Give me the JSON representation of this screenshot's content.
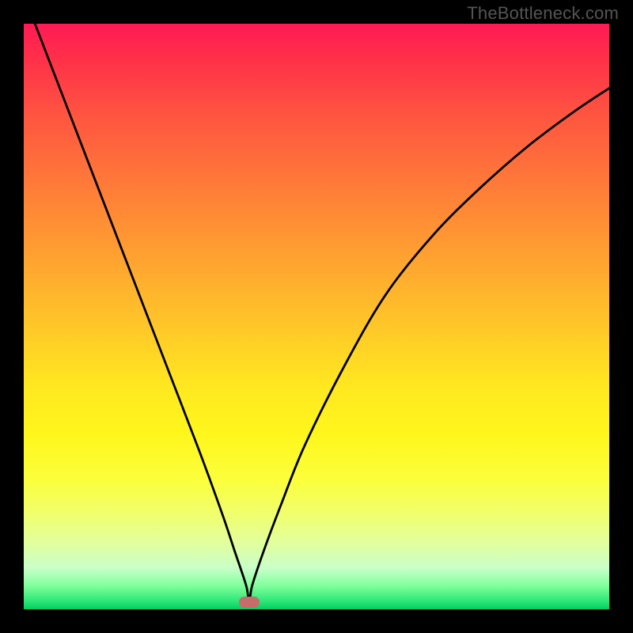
{
  "watermark": "TheBottleneck.com",
  "chart_data": {
    "type": "line",
    "title": "",
    "xlabel": "",
    "ylabel": "",
    "xlim": [
      0,
      100
    ],
    "ylim": [
      0,
      100
    ],
    "grid": false,
    "gradient_stops": [
      {
        "pos": 0,
        "color": "#ff1a55"
      },
      {
        "pos": 50,
        "color": "#ffc828"
      },
      {
        "pos": 78,
        "color": "#fbff3c"
      },
      {
        "pos": 100,
        "color": "#00d060"
      }
    ],
    "marker": {
      "x": 38.5,
      "y": 98.8,
      "color": "#c76b6b"
    },
    "series": [
      {
        "name": "bottleneck-curve",
        "x": [
          0,
          5,
          10,
          15,
          20,
          25,
          30,
          34,
          36,
          38,
          38.5,
          39,
          41,
          44,
          48,
          55,
          62,
          70,
          78,
          86,
          94,
          100
        ],
        "y": [
          -5,
          8,
          21,
          34,
          47,
          60,
          73,
          84,
          90,
          96,
          99,
          96,
          90,
          82,
          72,
          58,
          46,
          36,
          28,
          21,
          15,
          11
        ]
      }
    ],
    "notes": "V-shaped curve with minimum near x≈38.5 touching the green bottom band; y shown here is distance from top as percentage (higher y = lower on screen = better/green)."
  }
}
